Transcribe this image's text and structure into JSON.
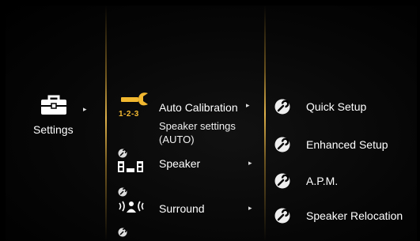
{
  "root_menu": {
    "label": "Settings",
    "arrow": "▸"
  },
  "settings_menu": {
    "items": [
      {
        "label": "Auto Calibration",
        "arrow": "▸",
        "badge": "1-2-3",
        "description": "Speaker settings (AUTO)"
      },
      {
        "label": "Speaker",
        "arrow": "▸"
      },
      {
        "label": "Surround",
        "arrow": "▸"
      }
    ]
  },
  "submenu": {
    "items": [
      {
        "label": "Quick Setup"
      },
      {
        "label": "Enhanced Setup"
      },
      {
        "label": "A.P.M."
      },
      {
        "label": "Speaker Relocation"
      }
    ]
  },
  "colors": {
    "accent": "#e0b24a",
    "icon_gold": "#f2b830",
    "text": "#ffffff",
    "background": "#000000"
  }
}
